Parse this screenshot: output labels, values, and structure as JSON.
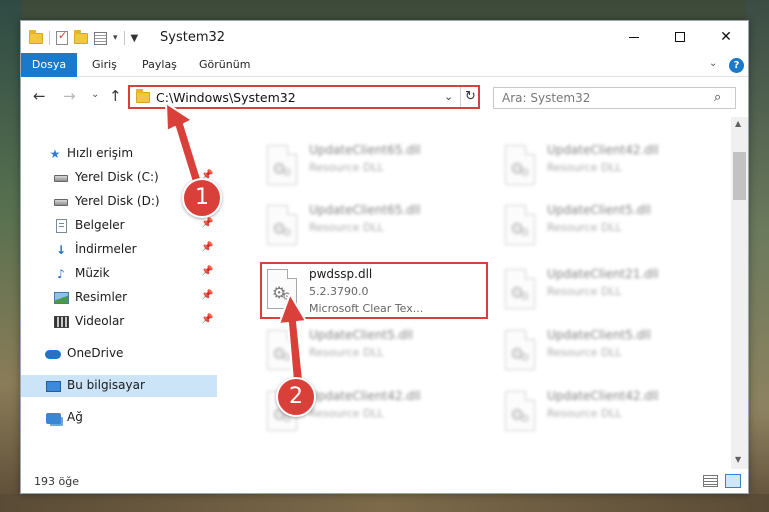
{
  "window": {
    "title": "System32",
    "controls": {
      "min": "—",
      "max": "☐",
      "close": "✕"
    }
  },
  "ribbon": {
    "tabs": [
      "Dosya",
      "Giriş",
      "Paylaş",
      "Görünüm"
    ],
    "help": "?"
  },
  "address": {
    "path": "C:\\Windows\\System32",
    "refresh": "↻"
  },
  "search": {
    "placeholder": "Ara: System32"
  },
  "nav": {
    "quick_access": "Hızlı erişim",
    "items": [
      {
        "label": "Yerel Disk (C:)",
        "icon": "hard-disk-icon",
        "pinned": true
      },
      {
        "label": "Yerel Disk (D:)",
        "icon": "hard-disk-icon",
        "pinned": false
      },
      {
        "label": "Belgeler",
        "icon": "documents-icon",
        "pinned": true
      },
      {
        "label": "İndirmeler",
        "icon": "downloads-icon",
        "pinned": true
      },
      {
        "label": "Müzik",
        "icon": "music-icon",
        "pinned": true
      },
      {
        "label": "Resimler",
        "icon": "pictures-icon",
        "pinned": true
      },
      {
        "label": "Videolar",
        "icon": "videos-icon",
        "pinned": true
      }
    ],
    "onedrive": "OneDrive",
    "this_pc": "Bu bilgisayar",
    "network": "Ağ"
  },
  "files": {
    "highlighted": {
      "name": "pwdssp.dll",
      "version": "5.2.3790.0",
      "description": "Microsoft Clear Tex..."
    },
    "left_column": [
      {
        "name": "UpdateClient65.dll",
        "type": "Resource DLL"
      },
      {
        "name": "UpdateClient65.dll",
        "type": "Resource DLL"
      },
      {
        "name": "UpdateClient5.dll",
        "type": "Resource DLL"
      },
      {
        "name": "UpdateClient42.dll",
        "type": "Resource DLL"
      }
    ],
    "right_column": [
      {
        "name": "UpdateClient42.dll",
        "type": "Resource DLL"
      },
      {
        "name": "UpdateClient5.dll",
        "type": "Resource DLL"
      },
      {
        "name": "UpdateClient21.dll",
        "type": "Resource DLL"
      },
      {
        "name": "UpdateClient5.dll",
        "type": "Resource DLL"
      },
      {
        "name": "UpdateClient42.dll",
        "type": "Resource DLL"
      }
    ]
  },
  "status": {
    "count": "193 öğe"
  },
  "annotations": {
    "step1": "1",
    "step2": "2"
  },
  "colors": {
    "accent": "#1979ca",
    "annotation": "#d9403a",
    "selection": "#cce4f7"
  }
}
